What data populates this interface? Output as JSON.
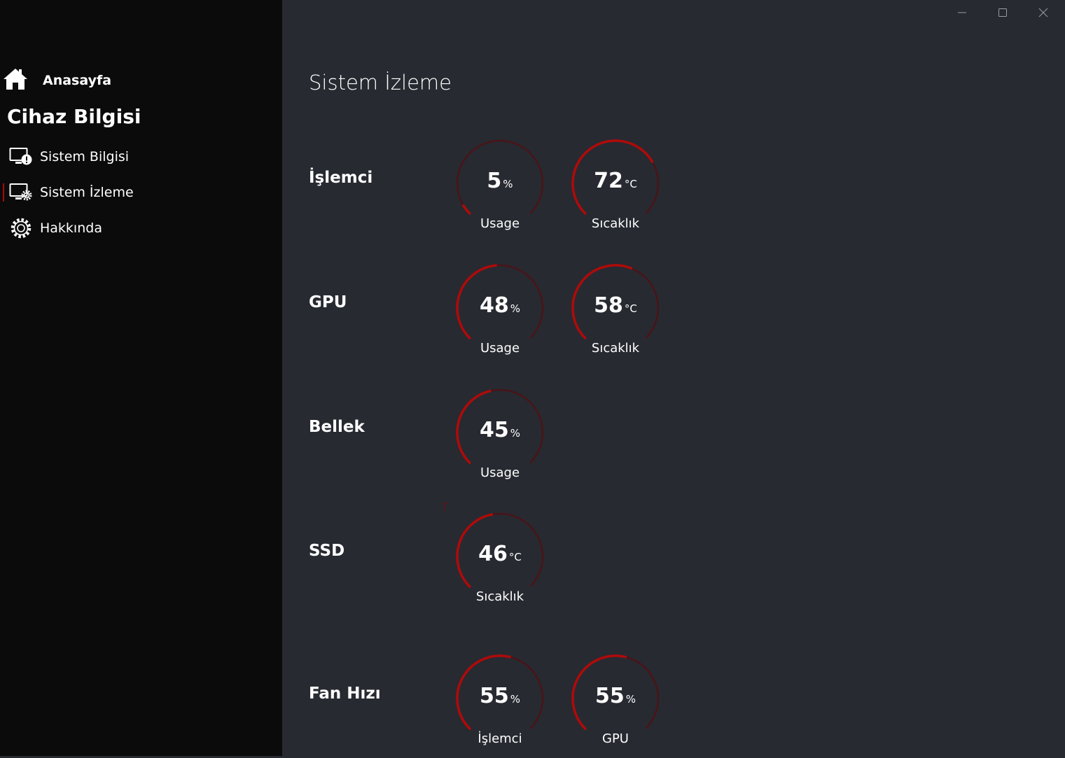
{
  "sidebar": {
    "home_label": "Anasayfa",
    "section_title": "Cihaz Bilgisi",
    "items": [
      {
        "label": "Sistem Bilgisi",
        "icon": "monitor-info-icon"
      },
      {
        "label": "Sistem İzleme",
        "icon": "monitor-gear-icon",
        "selected": true
      },
      {
        "label": "Hakkında",
        "icon": "gear-icon"
      }
    ]
  },
  "window_controls": [
    "minimize",
    "maximize",
    "close"
  ],
  "page": {
    "title": "Sistem İzleme",
    "rows": [
      {
        "label": "İşlemci",
        "gauges": [
          {
            "value": "5",
            "unit": "%",
            "label": "Usage",
            "fraction": 0.05
          },
          {
            "value": "72",
            "unit": "°C",
            "label": "Sıcaklık",
            "fraction": 0.72
          }
        ]
      },
      {
        "label": "GPU",
        "gauges": [
          {
            "value": "48",
            "unit": "%",
            "label": "Usage",
            "fraction": 0.48
          },
          {
            "value": "58",
            "unit": "°C",
            "label": "Sıcaklık",
            "fraction": 0.58
          }
        ]
      },
      {
        "label": "Bellek",
        "gauges": [
          {
            "value": "45",
            "unit": "%",
            "label": "Usage",
            "fraction": 0.45
          }
        ]
      },
      {
        "label": "SSD",
        "gauges": [
          {
            "value": "46",
            "unit": "°C",
            "label": "Sıcaklık",
            "fraction": 0.46
          }
        ]
      },
      {
        "label": "Fan Hızı",
        "gauges": [
          {
            "value": "55",
            "unit": "%",
            "label": "İşlemci",
            "fraction": 0.55
          },
          {
            "value": "55",
            "unit": "%",
            "label": "GPU",
            "fraction": 0.55
          }
        ]
      }
    ]
  },
  "colors": {
    "sidebar_bg": "#0b0b0c",
    "main_bg": "#272a31",
    "accent": "#b00a0a",
    "track": "#4a1418",
    "text": "#ffffff"
  }
}
